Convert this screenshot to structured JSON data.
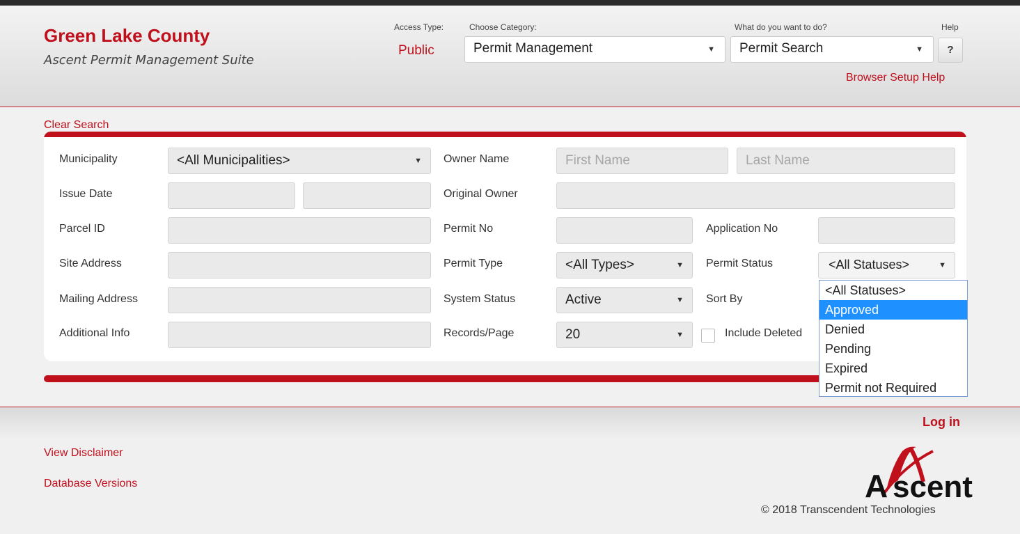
{
  "header": {
    "county": "Green Lake County",
    "suite": "Ascent Permit Management Suite",
    "access_type_label": "Access Type:",
    "access_type_value": "Public",
    "category_label": "Choose Category:",
    "category_value": "Permit Management",
    "action_label": "What do you want to do?",
    "action_value": "Permit Search",
    "help_label": "Help",
    "help_button": "?",
    "browser_setup_help": "Browser Setup Help"
  },
  "search": {
    "clear_search": "Clear Search",
    "municipality_label": "Municipality",
    "municipality_value": "<All Municipalities>",
    "owner_name_label": "Owner Name",
    "first_name_placeholder": "First Name",
    "last_name_placeholder": "Last Name",
    "issue_date_label": "Issue Date",
    "original_owner_label": "Original Owner",
    "parcel_id_label": "Parcel ID",
    "permit_no_label": "Permit No",
    "application_no_label": "Application No",
    "site_address_label": "Site Address",
    "permit_type_label": "Permit Type",
    "permit_type_value": "<All Types>",
    "permit_status_label": "Permit Status",
    "permit_status_value": "<All Statuses>",
    "mailing_address_label": "Mailing Address",
    "system_status_label": "System Status",
    "system_status_value": "Active",
    "sort_by_label": "Sort By",
    "additional_info_label": "Additional Info",
    "records_page_label": "Records/Page",
    "records_page_value": "20",
    "include_deleted_label": "Include Deleted"
  },
  "status_dropdown": {
    "options": [
      "<All Statuses>",
      "Approved",
      "Denied",
      "Pending",
      "Expired",
      "Permit not Required"
    ],
    "highlighted": "Approved"
  },
  "footer": {
    "login": "Log in",
    "view_disclaimer": "View Disclaimer",
    "database_versions": "Database Versions",
    "logo_text": "Ascent",
    "copyright": "© 2018 Transcendent Technologies"
  },
  "colors": {
    "accent": "#c0101c",
    "highlight": "#1e90ff"
  }
}
